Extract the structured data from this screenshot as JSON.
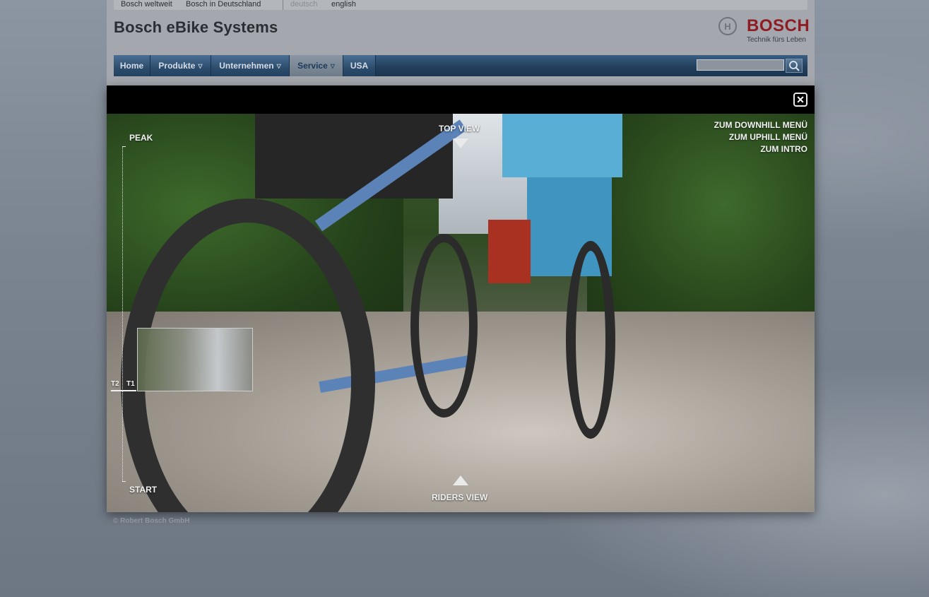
{
  "topbar": {
    "links": [
      "Bosch weltweit",
      "Bosch in Deutschland"
    ],
    "languages": [
      "deutsch",
      "english"
    ]
  },
  "header": {
    "site_title": "Bosch eBike Systems",
    "logo_text": "BOSCH",
    "logo_tagline": "Technik fürs Leben"
  },
  "nav": {
    "items": [
      {
        "label": "Home"
      },
      {
        "label": "Produkte"
      },
      {
        "label": "Unternehmen"
      },
      {
        "label": "Service"
      },
      {
        "label": "USA"
      }
    ],
    "search_value": ""
  },
  "overlay": {
    "close_symbol": "✕",
    "top_view": "TOP VIEW",
    "riders_view": "RIDERS VIEW",
    "menu_links": [
      "ZUM DOWNHILL MENÜ",
      "ZUM UPHILL MENÜ",
      "ZUM INTRO"
    ],
    "track": {
      "peak": "PEAK",
      "start": "START",
      "marker_t2": "T2",
      "marker_t1": "T1"
    }
  },
  "footer": {
    "copyright": "© Robert Bosch GmbH"
  }
}
